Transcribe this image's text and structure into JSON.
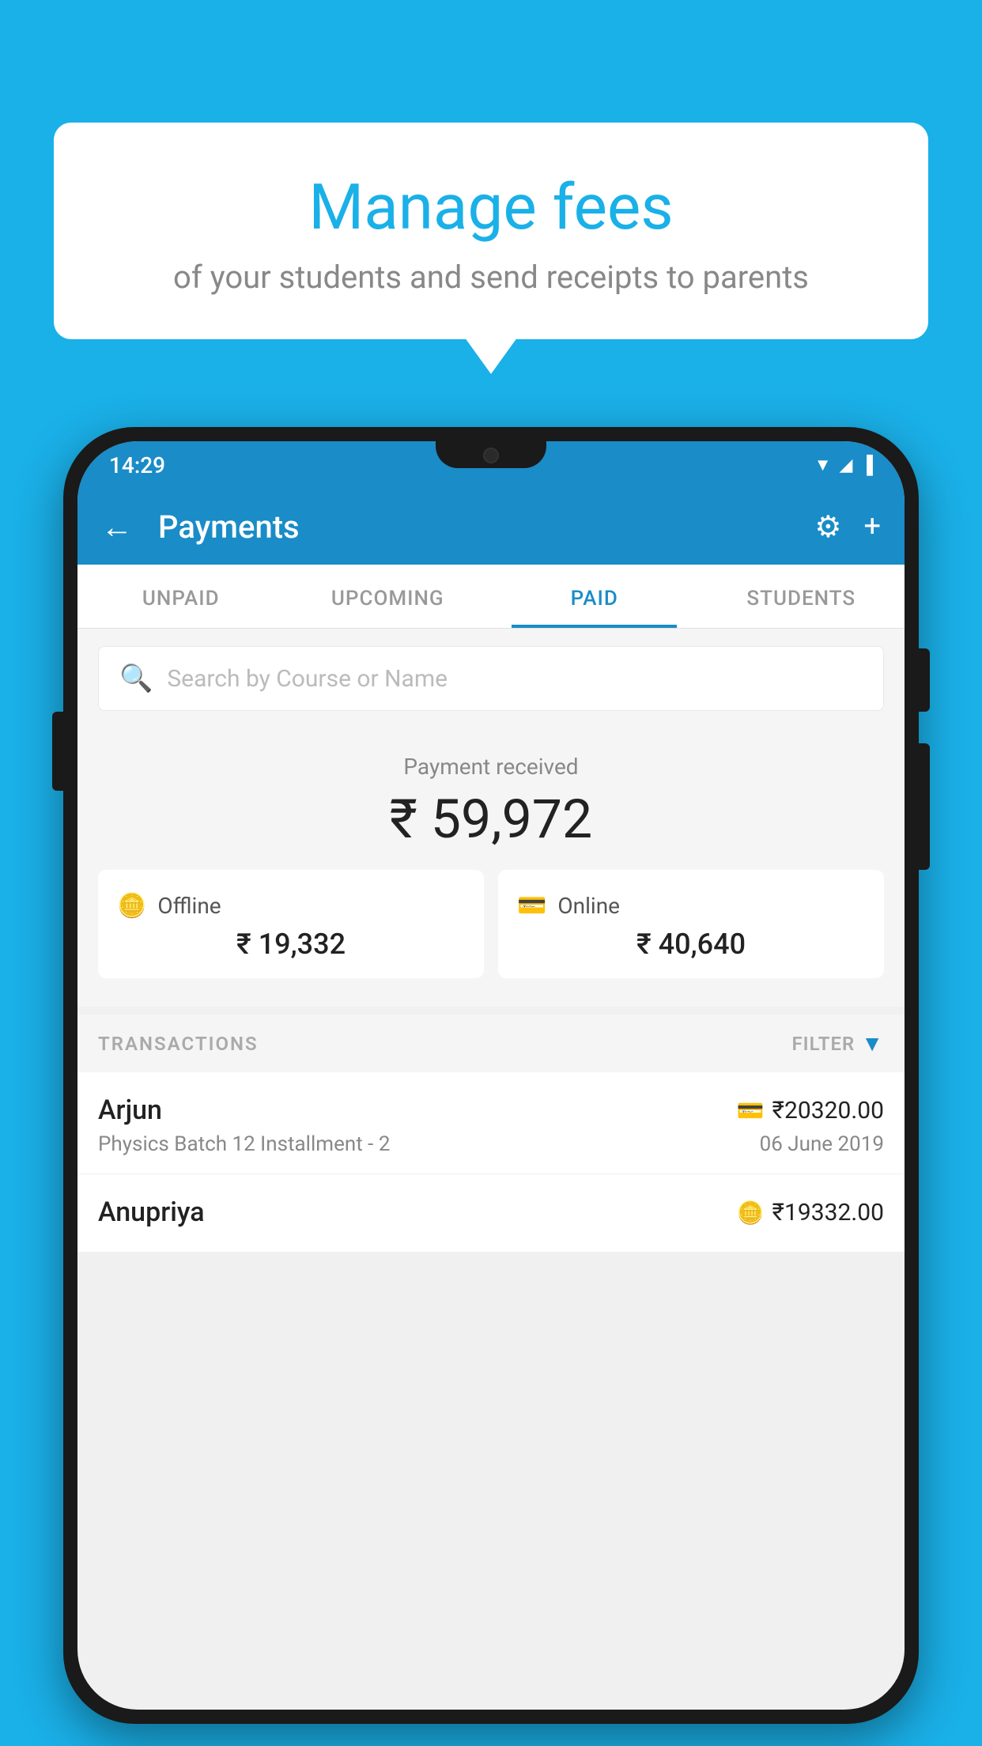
{
  "background_color": "#1ab0e8",
  "speech_bubble": {
    "title": "Manage fees",
    "subtitle": "of your students and send receipts to parents"
  },
  "phone": {
    "status_bar": {
      "time": "14:29",
      "icons": "▼◀▐"
    },
    "app_bar": {
      "title": "Payments",
      "back_label": "←",
      "settings_label": "⚙",
      "add_label": "+"
    },
    "tabs": [
      {
        "label": "UNPAID",
        "active": false
      },
      {
        "label": "UPCOMING",
        "active": false
      },
      {
        "label": "PAID",
        "active": true
      },
      {
        "label": "STUDENTS",
        "active": false
      }
    ],
    "search": {
      "placeholder": "Search by Course or Name"
    },
    "payment_summary": {
      "label": "Payment received",
      "amount": "₹ 59,972",
      "offline_label": "Offline",
      "offline_amount": "₹ 19,332",
      "online_label": "Online",
      "online_amount": "₹ 40,640"
    },
    "transactions": {
      "header_label": "TRANSACTIONS",
      "filter_label": "FILTER",
      "items": [
        {
          "name": "Arjun",
          "course": "Physics Batch 12 Installment - 2",
          "amount": "₹20320.00",
          "date": "06 June 2019",
          "type": "online"
        },
        {
          "name": "Anupriya",
          "course": "",
          "amount": "₹19332.00",
          "date": "",
          "type": "offline"
        }
      ]
    }
  }
}
